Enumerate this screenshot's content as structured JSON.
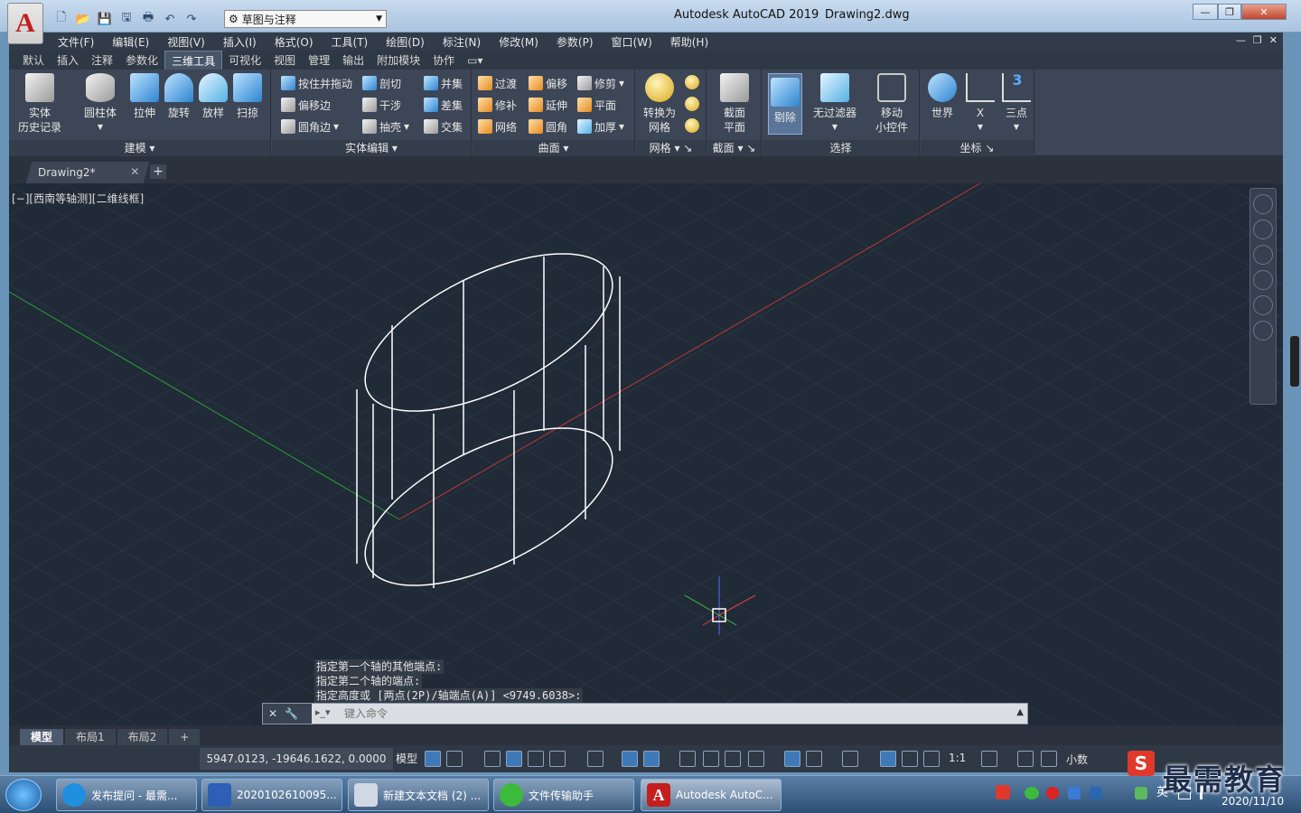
{
  "app": {
    "title": "Autodesk AutoCAD 2019",
    "file": "Drawing2.dwg",
    "logo": "A",
    "workspace": "草图与注释"
  },
  "menubar": [
    "文件(F)",
    "编辑(E)",
    "视图(V)",
    "插入(I)",
    "格式(O)",
    "工具(T)",
    "绘图(D)",
    "标注(N)",
    "修改(M)",
    "参数(P)",
    "窗口(W)",
    "帮助(H)"
  ],
  "ribbon_tabs": [
    "默认",
    "插入",
    "注释",
    "参数化",
    "三维工具",
    "可视化",
    "视图",
    "管理",
    "输出",
    "附加模块",
    "协作"
  ],
  "ribbon_active_tab": "三维工具",
  "panels": {
    "modeling": {
      "title": "建模",
      "history_line1": "实体",
      "history_line2": "历史记录",
      "cylinder": "圆柱体",
      "extrude": "拉伸",
      "revolve": "旋转",
      "loft": "放样",
      "sweep": "扫掠"
    },
    "solid_edit": {
      "title": "实体编辑",
      "presspull": "按住并拖动",
      "offset_edge": "偏移边",
      "fillet_edge": "圆角边",
      "slice": "剖切",
      "interfere": "干涉",
      "shell": "抽壳",
      "union": "并集",
      "subtract": "差集",
      "intersect": "交集"
    },
    "surface": {
      "title": "曲面",
      "blend": "过渡",
      "patch": "修补",
      "network": "网络",
      "offset": "偏移",
      "extend": "延伸",
      "fillet": "圆角",
      "trim": "修剪",
      "planar": "平面",
      "thicken": "加厚"
    },
    "mesh": {
      "title": "网格",
      "convert_line1": "转换为",
      "convert_line2": "网格"
    },
    "section": {
      "title": "截面",
      "plane_line1": "截面",
      "plane_line2": "平面"
    },
    "selection": {
      "title": "选择",
      "cull": "剔除",
      "no_filter": "无过滤器",
      "gizmo_line1": "移动",
      "gizmo_line2": "小控件"
    },
    "coordinates": {
      "title": "坐标",
      "world": "世界",
      "x": "X",
      "three_point": "三点"
    }
  },
  "doc_tab": "Drawing2*",
  "view_label": "[−][西南等轴测][二维线框]",
  "command_history": [
    "指定第一个轴的其他端点:",
    "指定第二个轴的端点:",
    "指定高度或 [两点(2P)/轴端点(A)] <9749.6038>:"
  ],
  "command_placeholder": "键入命令",
  "layout_tabs": [
    "模型",
    "布局1",
    "布局2"
  ],
  "status": {
    "coords": "5947.0123, -19646.1622, 0.0000",
    "model": "模型",
    "scale": "1:1",
    "units": "小数"
  },
  "taskbar": {
    "items": [
      "发布提问 - 最需...",
      "2020102610095...",
      "新建文本文档 (2) ...",
      "文件传输助手",
      "Autodesk AutoC..."
    ],
    "ime": "英",
    "date": "2020/11/10"
  },
  "watermark": "最需教育",
  "colors": {
    "viewport_bg": "#212a37",
    "grid_line": "#2b3646",
    "x_axis": "#b83a3a",
    "y_axis": "#2f9b3a",
    "geometry": "#ffffff",
    "ribbon_bg": "#3c4656"
  }
}
